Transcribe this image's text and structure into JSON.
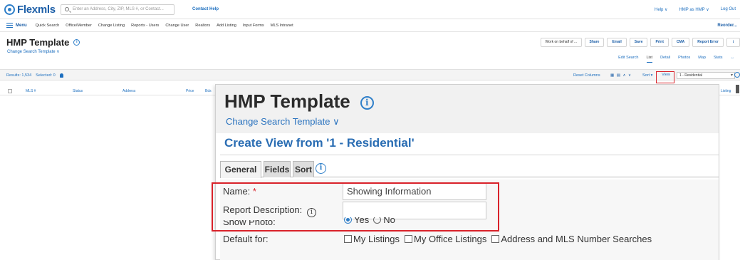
{
  "topbar": {
    "logo": "Flexmls",
    "search_placeholder": "Enter an Address, City, ZIP, MLS #, or Contact...",
    "contact_help": "Contact Help",
    "right_links": [
      "Help ∨",
      "HMP as HMP ∨",
      "Log Out"
    ]
  },
  "menubar": {
    "menu_label": "Menu",
    "items": [
      "Quick Search",
      "Office/Member",
      "Change Listing",
      "Reports - Users",
      "Change User",
      "Realtors",
      "Add Listing",
      "Input Forms",
      "MLS Intranet"
    ],
    "reorder": "Reorder..."
  },
  "bg": {
    "title": "HMP Template",
    "subtitle": "Change Search Template ∨",
    "actions": [
      "Work on behalf of ...",
      "Share",
      "Email",
      "Save",
      "Print",
      "CMA",
      "Report Error",
      "⋮"
    ],
    "view_tabs": [
      "Edit Search",
      "List",
      "Detail",
      "Photos",
      "Map",
      "Stats",
      "↔"
    ],
    "results": "Results: 1,534",
    "selected": "Selected: 0",
    "reset_columns": "Reset Columns",
    "grid_icons": "▦ ▤  ∧  ∨",
    "sort": "Sort ▾",
    "view": "View",
    "view_select": "1 - Residential",
    "columns": [
      "MLS #",
      "Status",
      "Address",
      "Price",
      "Bds",
      "Listing"
    ]
  },
  "dialog": {
    "title": "HMP Template",
    "info": "i",
    "subtitle": "Change Search Template ∨",
    "create_view": "Create View from '1 - Residential'",
    "tabs": [
      "General",
      "Fields",
      "Sort"
    ],
    "form": {
      "name_label": "Name:",
      "required_mark": "*",
      "name_value": "Showing Information",
      "description_label": "Report Description:",
      "description_value": "",
      "show_photo_label": "Show Photo:",
      "yes": "Yes",
      "no": "No",
      "default_for_label": "Default for:",
      "default_options": [
        "My Listings",
        "My Office Listings",
        "Address and MLS Number Searches"
      ]
    }
  },
  "colors": {
    "accent_blue": "#2a6db3",
    "highlight_red": "#d9222a"
  }
}
